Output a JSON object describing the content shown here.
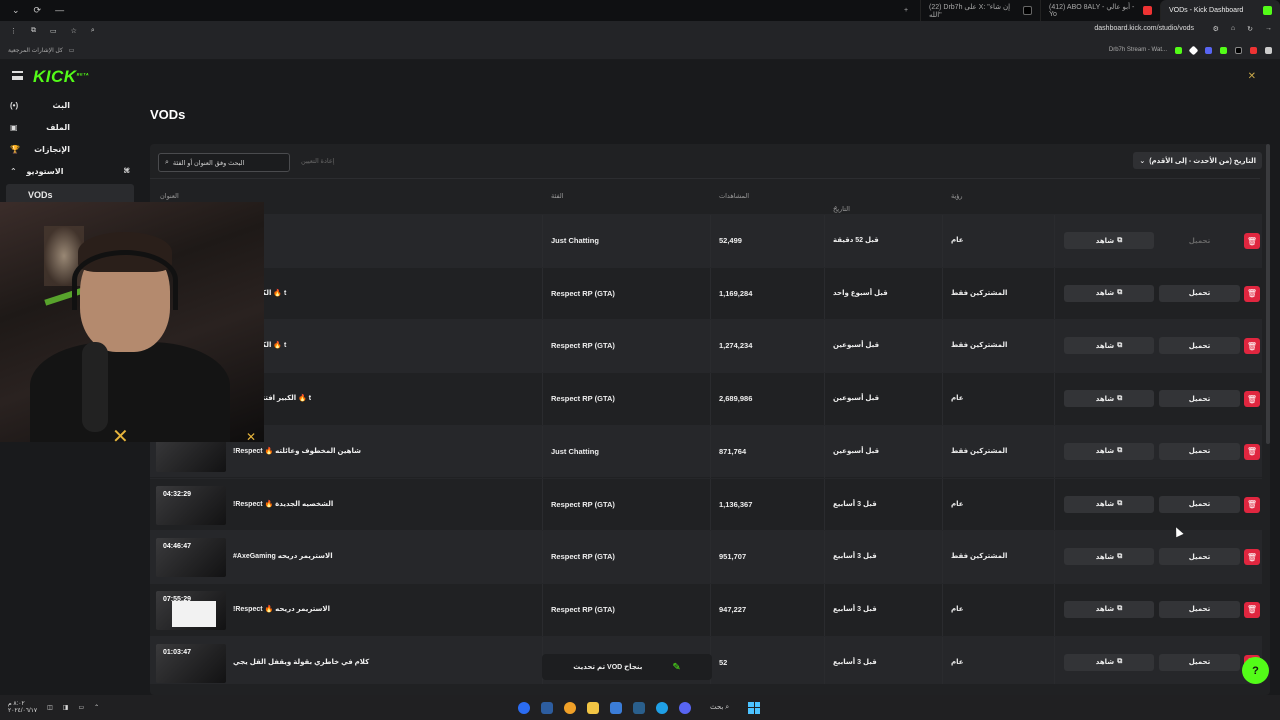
{
  "browser": {
    "window_buttons": [
      "⌄",
      "⟳",
      "—"
    ],
    "tabs": [
      {
        "title": "VODs - Kick Dashboard",
        "active": true
      },
      {
        "title": "(412) ABO 8ALY - أبو عالي - Yo"
      },
      {
        "title": "(22) Drb7h على X: \"إن شاء الله\""
      }
    ],
    "new_tab": "+",
    "url": "dashboard.kick.com/studio/vods",
    "bookmarks_left": "كل الإشارات المرجعية",
    "bookmarks_right": "Drb7h Stream - Wat..."
  },
  "app": {
    "logo": "KICK",
    "logo_badge": "BETA",
    "sidebar": {
      "items": [
        {
          "label": "البث",
          "icon": "(•)"
        },
        {
          "label": "الملف",
          "icon": "▣"
        },
        {
          "label": "الإنجازات",
          "icon": "🏆"
        },
        {
          "label": "الاستوديو",
          "icon": "⌃"
        }
      ],
      "sub_active": "VODs"
    },
    "page_title": "VODs",
    "search_placeholder": "البحث وفق العنوان أو الفئة",
    "reset_label": "إعادة التعيين",
    "sort_label": "التاريخ (من الأحدث - إلى الأقدم)",
    "columns": {
      "title": "العنوان",
      "category": "الفئة",
      "views": "المشاهدات",
      "date": "التاريخ",
      "visibility": "رؤية"
    },
    "watch_label": "شاهد",
    "download_label": "تحميل",
    "rows": [
      {
        "duration": "",
        "title": "",
        "category": "Just Chatting",
        "views": "52,499",
        "date": "قبل 52 دقيقة",
        "visibility": "عام",
        "download_disabled": true
      },
      {
        "duration": "",
        "title": "الكبير جاكم 🔥 t",
        "category": "Respect RP (GTA)",
        "views": "1,169,284",
        "date": "قبل أسبوع واحد",
        "visibility": "المشتركين فقط"
      },
      {
        "duration": "",
        "title": "الكبير جاكم 🔥 t",
        "category": "Respect RP (GTA)",
        "views": "1,274,234",
        "date": "قبل أسبوعين",
        "visibility": "المشتركين فقط"
      },
      {
        "duration": "",
        "title": "الكبير افتتاح لقل 3 🔥 t",
        "category": "Respect RP (GTA)",
        "views": "2,689,986",
        "date": "قبل أسبوعين",
        "visibility": "عام"
      },
      {
        "duration": "",
        "title": "!Respect 🔥 شاهين المخطوف وعائلته",
        "category": "Just Chatting",
        "views": "871,764",
        "date": "قبل أسبوعين",
        "visibility": "المشتركين فقط"
      },
      {
        "duration": "04:32:29",
        "title": "!Respect 🔥 الشخصيه الجديدة",
        "category": "Respect RP (GTA)",
        "views": "1,136,367",
        "date": "قبل 3 أسابيع",
        "visibility": "عام"
      },
      {
        "duration": "04:46:47",
        "title": "#AxeGaming الاستريمر دريحه",
        "category": "Respect RP (GTA)",
        "views": "951,707",
        "date": "قبل 3 أسابيع",
        "visibility": "المشتركين فقط"
      },
      {
        "duration": "07:55:29",
        "title": "!Respect 🔥 الاستريمر دريحه",
        "category": "Respect RP (GTA)",
        "views": "947,227",
        "date": "قبل 3 أسابيع",
        "visibility": "عام"
      },
      {
        "duration": "01:03:47",
        "title": "كلام في خاطري بقولة ويقفل القل يجي",
        "category": "",
        "views": "52",
        "date": "قبل 3 أسابيع",
        "visibility": "عام"
      }
    ],
    "toast": "تم تحديث VOD بنجاح",
    "help_icon": "?"
  },
  "taskbar": {
    "search": "بحث",
    "clock_line1": "٨:٠٢ م",
    "clock_line2": "٢٠٢٤/٠٦/١٧"
  },
  "colors": {
    "accent": "#53fc18",
    "danger": "#e0263f"
  }
}
